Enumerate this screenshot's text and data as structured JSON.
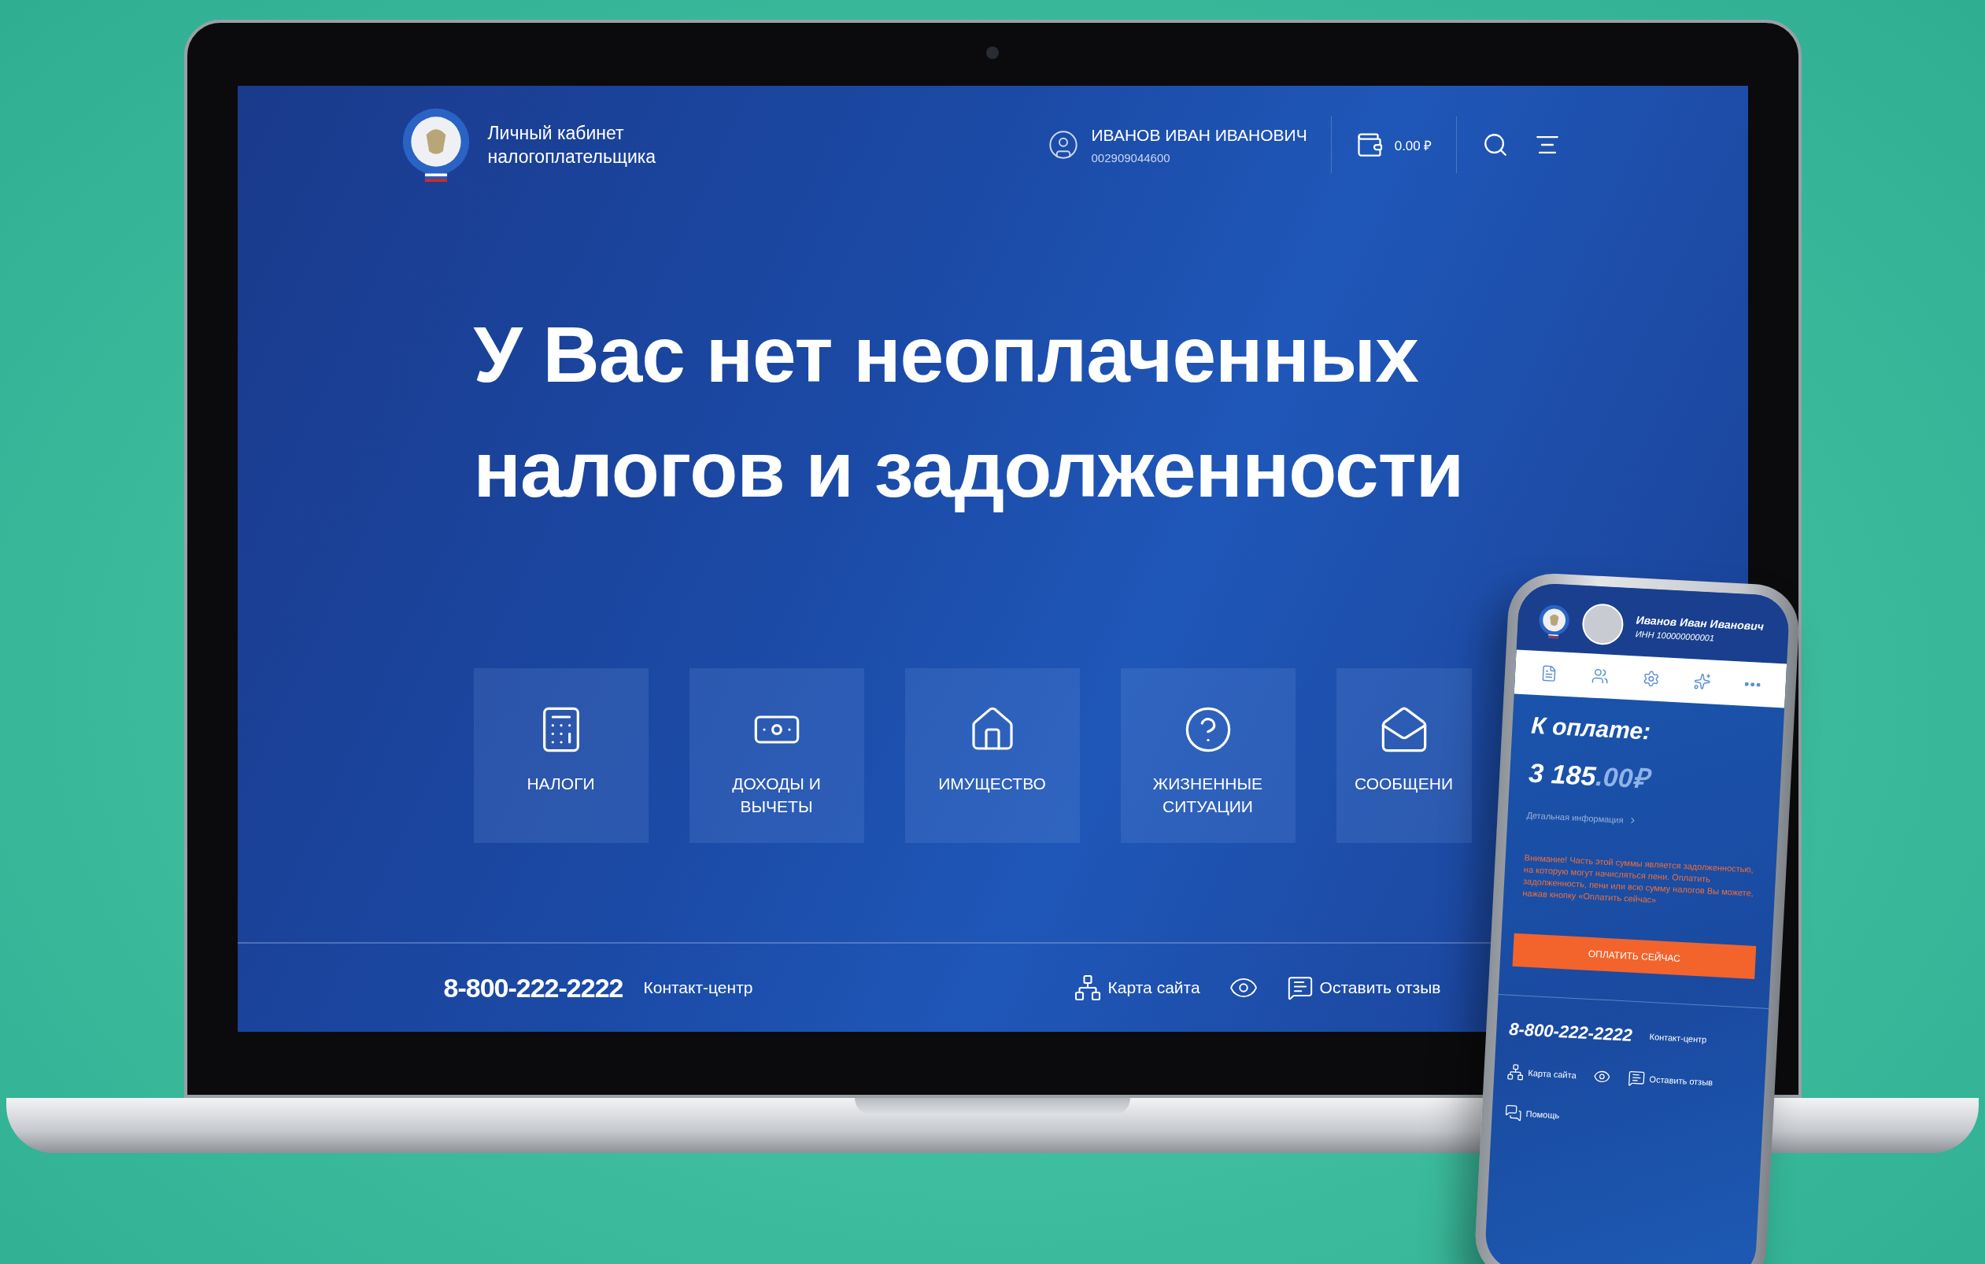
{
  "laptop": {
    "header": {
      "title_lines": [
        "Личный кабинет",
        "налогоплательщика"
      ],
      "user": {
        "name": "ИВАНОВ ИВАН ИВАНОВИЧ",
        "inn": "002909044600"
      },
      "balance": "0.00 ₽"
    },
    "headline_lines": [
      "У Вас нет неоплаченных",
      "налогов и задолженности"
    ],
    "tiles": [
      {
        "label_lines": [
          "НАЛОГИ"
        ]
      },
      {
        "label_lines": [
          "ДОХОДЫ И",
          "ВЫЧЕТЫ"
        ]
      },
      {
        "label_lines": [
          "ИМУЩЕСТВО"
        ]
      },
      {
        "label_lines": [
          "ЖИЗНЕННЫЕ",
          "СИТУАЦИИ"
        ]
      },
      {
        "label_lines": [
          "СООБЩЕНИ"
        ]
      }
    ],
    "footer": {
      "phone": "8-800-222-2222",
      "phone_label": "Контакт-центр",
      "sitemap": "Карта сайта",
      "feedback": "Оставить отзыв"
    }
  },
  "phone": {
    "user": {
      "name": "Иванов Иван Иванович",
      "inn": "ИНН 100000000001"
    },
    "title": "К оплате:",
    "amount_whole": "3 185",
    "amount_fraction": ".00₽",
    "details_link": "Детальная информация",
    "warning": "Внимание! Часть этой суммы является задолженностью, на которую могут начисляться пени. Оплатить задолженность, пени или всю сумму налогов Вы можете, нажав кнопку «Оплатить сейчас»",
    "pay_button": "ОПЛАТИТЬ СЕЙЧАС",
    "footer": {
      "phone": "8-800-222-2222",
      "phone_label": "Контакт-центр",
      "sitemap": "Карта сайта",
      "feedback": "Оставить отзыв",
      "help": "Помощь"
    }
  }
}
